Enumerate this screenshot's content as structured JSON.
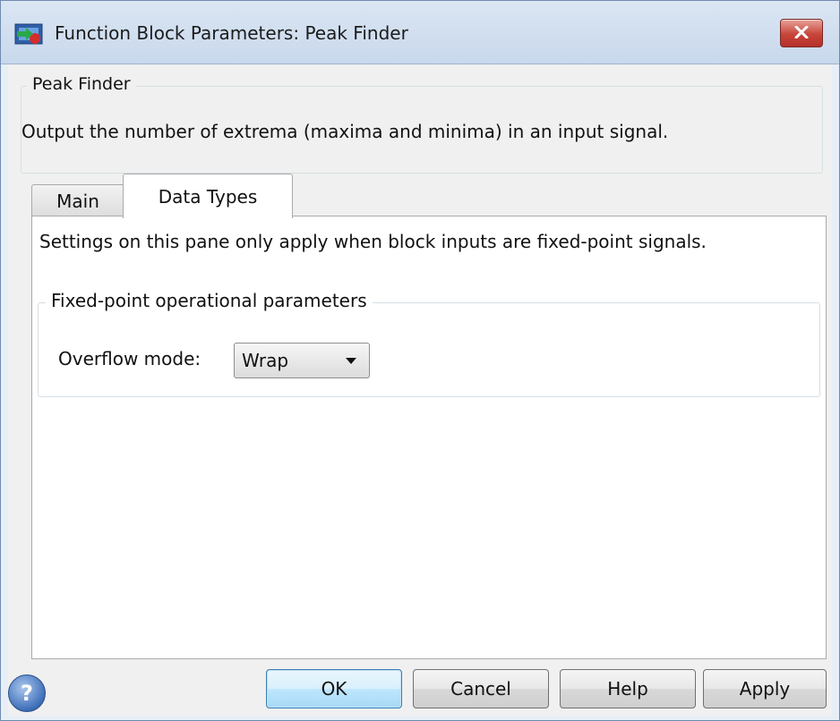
{
  "window": {
    "title": "Function Block Parameters: Peak Finder"
  },
  "description": {
    "group_title": "Peak Finder",
    "text": "Output the number of extrema (maxima and minima) in an input signal."
  },
  "tabs": [
    {
      "label": "Main",
      "selected": false
    },
    {
      "label": "Data Types",
      "selected": true
    }
  ],
  "pane": {
    "note": "Settings on this pane only apply when block inputs are fixed-point signals.",
    "fixed_point_group": {
      "title": "Fixed-point operational parameters",
      "overflow_mode": {
        "label": "Overflow mode:",
        "value": "Wrap"
      }
    }
  },
  "buttons": {
    "ok": "OK",
    "cancel": "Cancel",
    "help": "Help",
    "apply": "Apply"
  },
  "icons": {
    "app": "simulink-block-icon",
    "close": "close-icon",
    "help": "help-question-icon"
  },
  "colors": {
    "ok_button_accent": "#3c7fb1",
    "close_button": "#c7453a"
  }
}
